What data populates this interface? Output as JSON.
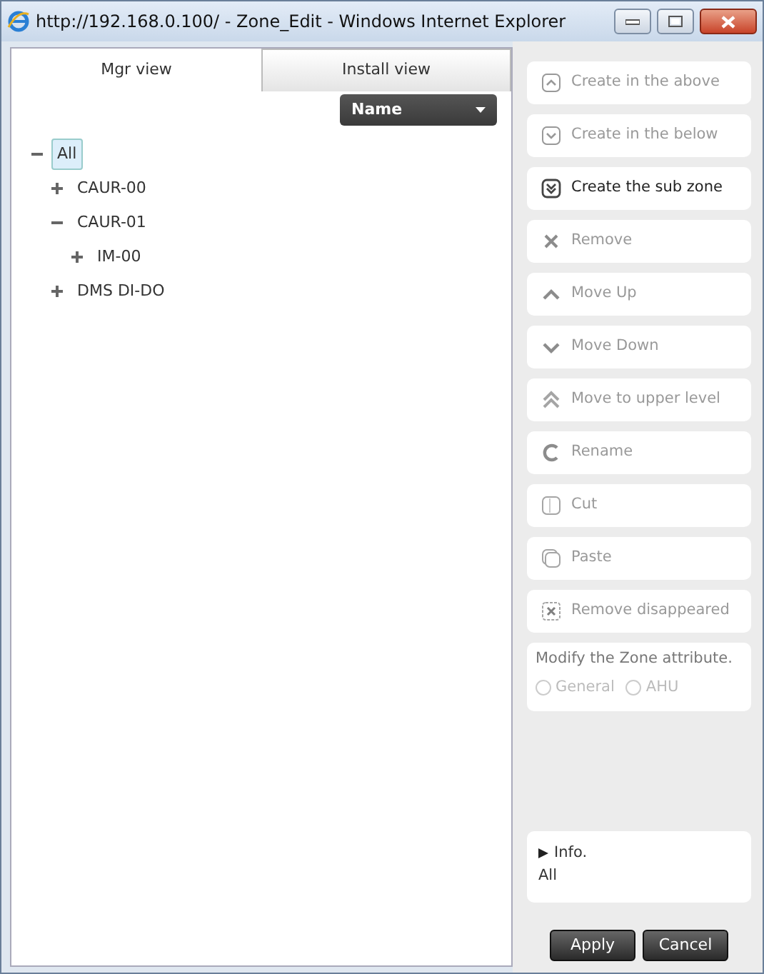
{
  "window": {
    "title": "http://192.168.0.100/ - Zone_Edit - Windows Internet Explorer"
  },
  "tabs": [
    {
      "label": "Mgr view",
      "selected": true
    },
    {
      "label": "Install view",
      "selected": false
    }
  ],
  "sort_dropdown": {
    "value": "Name"
  },
  "tree": [
    {
      "label": "All",
      "selected": true,
      "expanded": true,
      "children": [
        {
          "label": "CAUR-00",
          "selected": false,
          "expanded": false
        },
        {
          "label": "CAUR-01",
          "selected": false,
          "expanded": true,
          "children": [
            {
              "label": "IM-00",
              "selected": false,
              "expanded": false
            }
          ]
        },
        {
          "label": "DMS DI-DO",
          "selected": false,
          "expanded": false
        }
      ]
    }
  ],
  "actions": [
    {
      "label": "Create in the above",
      "disabled": true
    },
    {
      "label": "Create in the below",
      "disabled": true
    },
    {
      "label": "Create the sub zone",
      "disabled": false
    },
    {
      "label": "Remove",
      "disabled": true
    },
    {
      "label": "Move Up",
      "disabled": true
    },
    {
      "label": "Move Down",
      "disabled": true
    },
    {
      "label": "Move to upper level",
      "disabled": true
    },
    {
      "label": "Rename",
      "disabled": true
    },
    {
      "label": "Cut",
      "disabled": true
    },
    {
      "label": "Paste",
      "disabled": true
    },
    {
      "label": "Remove disappeared",
      "disabled": true
    }
  ],
  "zone_attribute": {
    "title": "Modify the Zone attribute.",
    "options": [
      {
        "label": "General",
        "selected": false,
        "disabled": true
      },
      {
        "label": "AHU",
        "selected": false,
        "disabled": true
      }
    ]
  },
  "info": {
    "title": "Info.",
    "value": "All"
  },
  "buttons": [
    "Apply",
    "Cancel"
  ]
}
